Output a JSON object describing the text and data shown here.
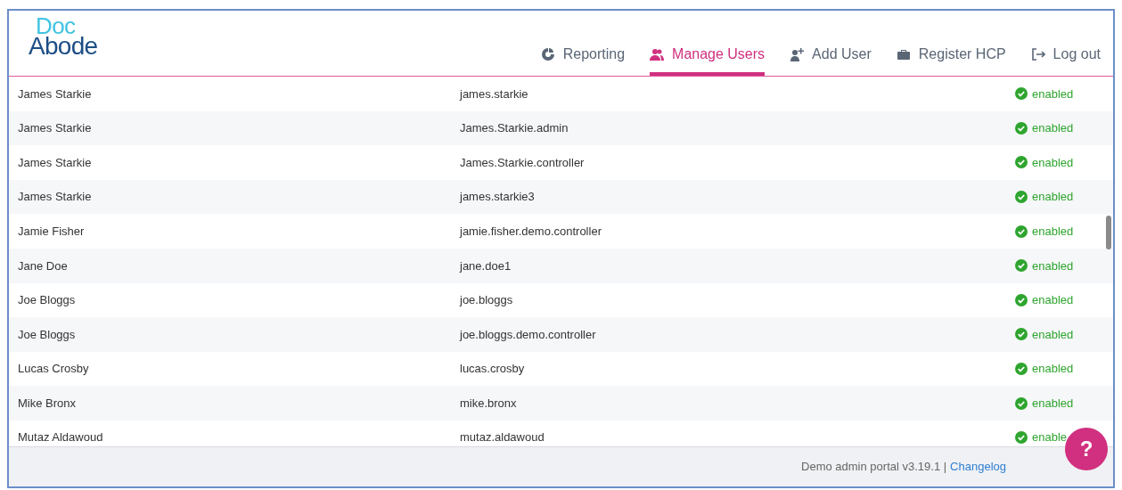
{
  "logo": {
    "top": "Doc",
    "bottom": "Abode"
  },
  "nav": [
    {
      "label": "Reporting",
      "kind": "chart",
      "selected": false
    },
    {
      "label": "Manage Users",
      "kind": "users",
      "selected": true
    },
    {
      "label": "Add User",
      "kind": "add-user",
      "selected": false
    },
    {
      "label": "Register HCP",
      "kind": "briefcase",
      "selected": false
    },
    {
      "label": "Log out",
      "kind": "logout",
      "selected": false
    }
  ],
  "users": [
    {
      "name": "James Starkie",
      "username": "james.starkie",
      "status": "enabled",
      "enabled": true
    },
    {
      "name": "James Starkie",
      "username": "James.Starkie.admin",
      "status": "enabled",
      "enabled": true
    },
    {
      "name": "James Starkie",
      "username": "James.Starkie.controller",
      "status": "enabled",
      "enabled": true
    },
    {
      "name": "James Starkie",
      "username": "james.starkie3",
      "status": "enabled",
      "enabled": true
    },
    {
      "name": "Jamie Fisher",
      "username": "jamie.fisher.demo.controller",
      "status": "enabled",
      "enabled": true
    },
    {
      "name": "Jane Doe",
      "username": "jane.doe1",
      "status": "enabled",
      "enabled": true
    },
    {
      "name": "Joe Bloggs",
      "username": "joe.bloggs",
      "status": "enabled",
      "enabled": true
    },
    {
      "name": "Joe Bloggs",
      "username": "joe.bloggs.demo.controller",
      "status": "enabled",
      "enabled": true
    },
    {
      "name": "Lucas Crosby",
      "username": "lucas.crosby",
      "status": "enabled",
      "enabled": true
    },
    {
      "name": "Mike Bronx",
      "username": "mike.bronx",
      "status": "enabled",
      "enabled": true
    },
    {
      "name": "Mutaz Aldawoud",
      "username": "mutaz.aldawoud",
      "status": "enable",
      "enabled": true
    }
  ],
  "footer": {
    "text": "Demo admin portal v3.19.1 |",
    "link": "Changelog"
  },
  "help_button": {
    "label": "?"
  }
}
